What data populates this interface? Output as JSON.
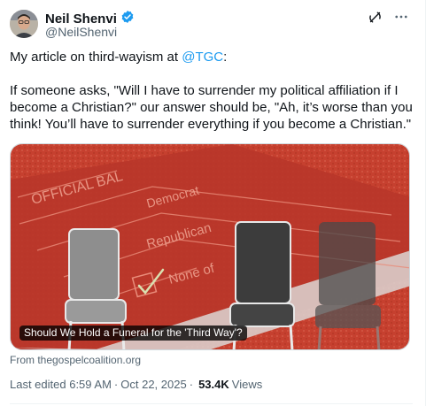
{
  "author": {
    "display_name": "Neil Shenvi",
    "handle": "@NeilShenvi",
    "verified": true,
    "verified_color": "#1d9bf0"
  },
  "icons": {
    "grok": "grok-icon",
    "more": "more-icon",
    "verified": "verified-badge-icon"
  },
  "tweet": {
    "line1_prefix": "My article on third-wayism at ",
    "line1_mention": "@TGC",
    "line1_suffix": ":",
    "paragraph2": "If someone asks, \"Will I have to surrender my political affiliation if I become a Christian?\" our answer should be, \"Ah, it’s worse than you think! You’ll have to surrender everything if you become a Christian.\""
  },
  "card": {
    "caption": "Should We Hold a Funeral for the 'Third Way'?",
    "ballot_words": [
      "OFFICIAL BAL",
      "Democrat",
      "Republican",
      "None of"
    ],
    "source": "From thegospelcoalition.org"
  },
  "meta": {
    "last_edited": "Last edited 6:59 AM",
    "date": "Oct 22, 2025",
    "views_count": "53.4K",
    "views_label": "Views",
    "separator": "·"
  },
  "colors": {
    "accent": "#1d9bf0",
    "text_primary": "#0f1419",
    "text_secondary": "#536471",
    "card_red": "#c8402e"
  }
}
